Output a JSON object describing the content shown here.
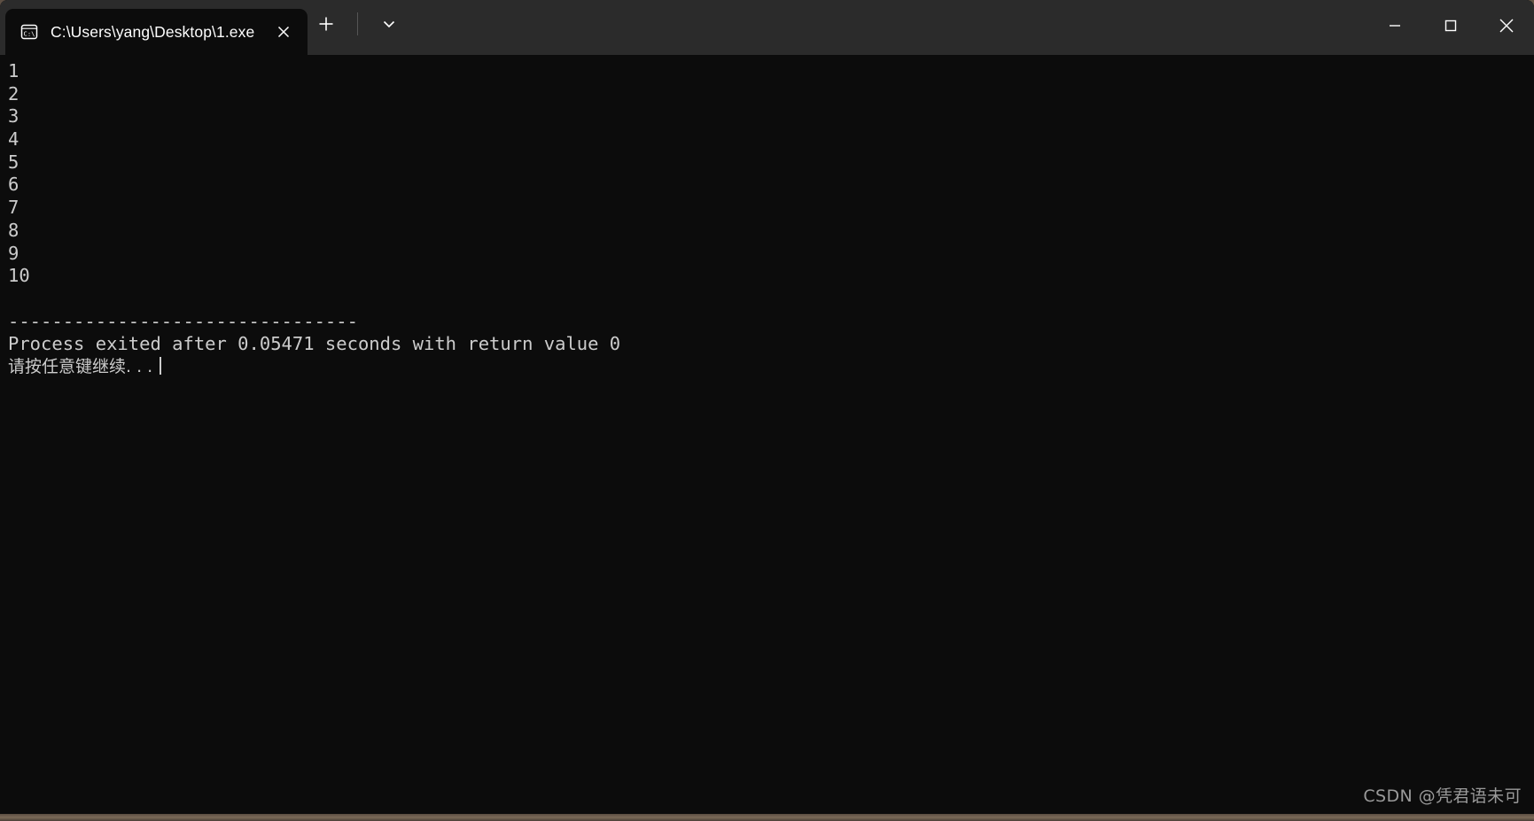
{
  "window": {
    "tab": {
      "icon": "console-cmd-icon",
      "icon_glyph": "C:\\",
      "title": "C:\\Users\\yang\\Desktop\\1.exe",
      "close_glyph": "✕"
    },
    "actions": {
      "new_tab_glyph": "＋",
      "dropdown_glyph": "⌄"
    },
    "controls": {
      "minimize_glyph": "—",
      "maximize_glyph": "□",
      "close_glyph": "✕"
    },
    "colors": {
      "titlebar": "#2b2b2b",
      "terminal_bg": "#0c0c0c",
      "terminal_fg": "#cccccc",
      "tab_active_bg": "#0c0c0c"
    }
  },
  "terminal": {
    "lines": [
      "1",
      "2",
      "3",
      "4",
      "5",
      "6",
      "7",
      "8",
      "9",
      "10",
      "",
      "--------------------------------",
      "Process exited after 0.05471 seconds with return value 0"
    ],
    "prompt_line": "请按任意键继续. . .",
    "cursor_visible": true
  },
  "watermark": {
    "text": "CSDN @凭君语未可"
  }
}
